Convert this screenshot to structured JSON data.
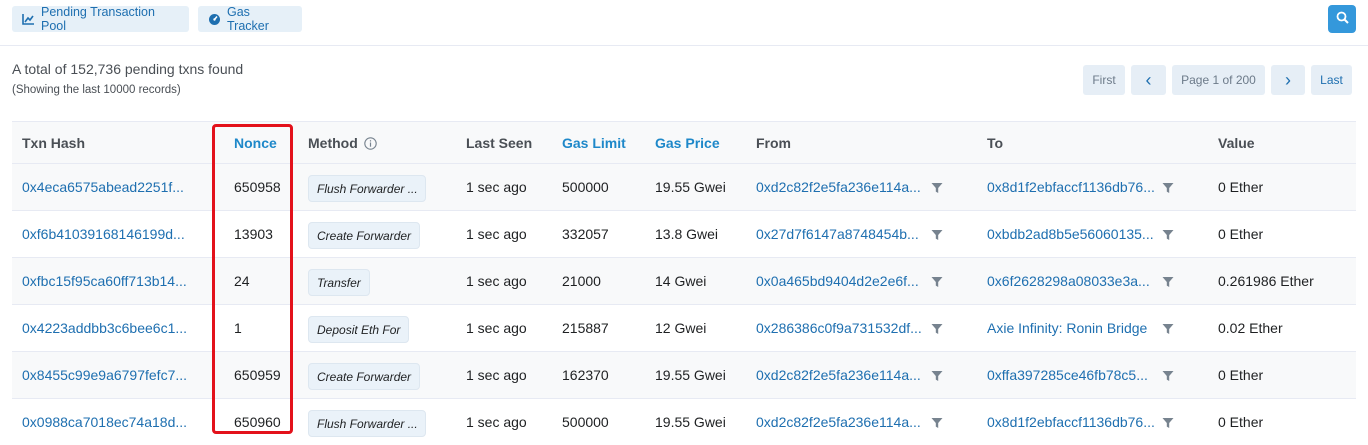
{
  "toolbar": {
    "pending_pool_label": "Pending Transaction Pool",
    "gas_tracker_label": "Gas Tracker"
  },
  "summary": {
    "total_text": "A total of 152,736 pending txns found",
    "sub_text": "(Showing the last 10000 records)"
  },
  "pagination": {
    "first": "First",
    "prev": "‹",
    "page_text": "Page 1 of 200",
    "next": "›",
    "last": "Last"
  },
  "table": {
    "headers": {
      "txn_hash": "Txn Hash",
      "nonce": "Nonce",
      "method": "Method",
      "last_seen": "Last Seen",
      "gas_limit": "Gas Limit",
      "gas_price": "Gas Price",
      "from": "From",
      "to": "To",
      "value": "Value"
    },
    "rows": [
      {
        "hash": "0x4eca6575abead2251f...",
        "nonce": "650958",
        "method": "Flush Forwarder ...",
        "last_seen": "1 sec ago",
        "gas_limit": "500000",
        "gas_price": "19.55 Gwei",
        "from": "0xd2c82f2e5fa236e114a...",
        "to": "0x8d1f2ebfaccf1136db76...",
        "value": "0 Ether"
      },
      {
        "hash": "0xf6b41039168146199d...",
        "nonce": "13903",
        "method": "Create Forwarder",
        "last_seen": "1 sec ago",
        "gas_limit": "332057",
        "gas_price": "13.8 Gwei",
        "from": "0x27d7f6147a8748454b...",
        "to": "0xbdb2ad8b5e56060135...",
        "value": "0 Ether"
      },
      {
        "hash": "0xfbc15f95ca60ff713b14...",
        "nonce": "24",
        "method": "Transfer",
        "last_seen": "1 sec ago",
        "gas_limit": "21000",
        "gas_price": "14 Gwei",
        "from": "0x0a465bd9404d2e2e6f...",
        "to": "0x6f2628298a08033e3a...",
        "value": "0.261986 Ether"
      },
      {
        "hash": "0x4223addbb3c6bee6c1...",
        "nonce": "1",
        "method": "Deposit Eth For",
        "last_seen": "1 sec ago",
        "gas_limit": "215887",
        "gas_price": "12 Gwei",
        "from": "0x286386c0f9a731532df...",
        "to": "Axie Infinity: Ronin Bridge",
        "value": "0.02 Ether"
      },
      {
        "hash": "0x8455c99e9a6797fefc7...",
        "nonce": "650959",
        "method": "Create Forwarder",
        "last_seen": "1 sec ago",
        "gas_limit": "162370",
        "gas_price": "19.55 Gwei",
        "from": "0xd2c82f2e5fa236e114a...",
        "to": "0xffa397285ce46fb78c5...",
        "value": "0 Ether"
      },
      {
        "hash": "0x0988ca7018ec74a18d...",
        "nonce": "650960",
        "method": "Flush Forwarder ...",
        "last_seen": "1 sec ago",
        "gas_limit": "500000",
        "gas_price": "19.55 Gwei",
        "from": "0xd2c82f2e5fa236e114a...",
        "to": "0x8d1f2ebfaccf1136db76...",
        "value": "0 Ether"
      }
    ]
  },
  "colors": {
    "link": "#1e6fb0",
    "accent": "#3498db",
    "highlight": "#e3111b"
  }
}
